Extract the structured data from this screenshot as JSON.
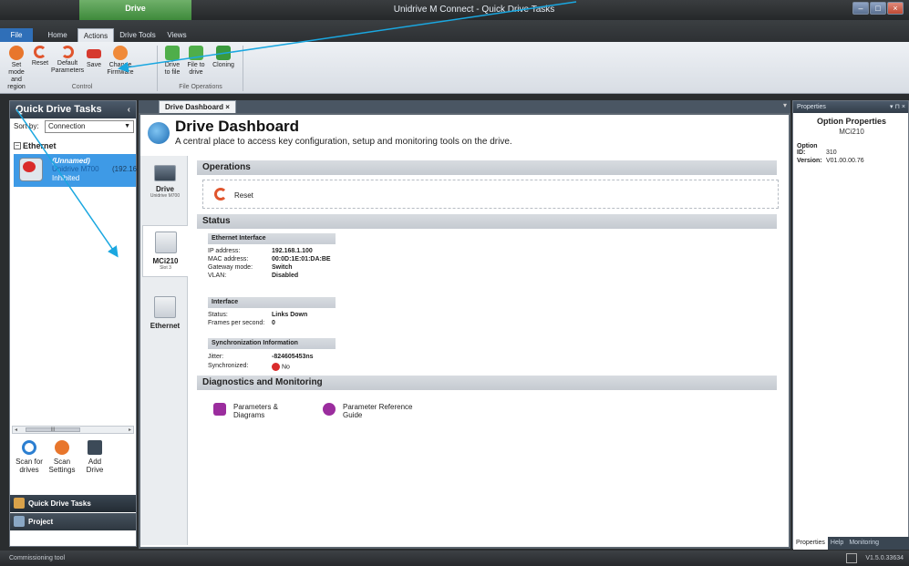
{
  "window": {
    "context_tab": "Drive",
    "title": "Unidrive M Connect - Quick Drive Tasks"
  },
  "ribbon_tabs": [
    "File",
    "Home",
    "Actions",
    "Drive Tools",
    "Views"
  ],
  "ribbon": {
    "control": {
      "label": "Control",
      "buttons": [
        {
          "l1": "Set mode",
          "l2": "and region",
          "icon_color": "#e8762c"
        },
        {
          "l1": "Reset",
          "l2": "",
          "icon_color": "#e0552d"
        },
        {
          "l1": "Default",
          "l2": "Parameters",
          "icon_color": "#e0552d"
        },
        {
          "l1": "Save",
          "l2": "",
          "icon_color": "#d63a2f"
        },
        {
          "l1": "Change",
          "l2": "Firmware",
          "icon_color": "#f08a3a"
        }
      ]
    },
    "file_operations": {
      "label": "File Operations",
      "buttons": [
        {
          "l1": "Drive",
          "l2": "to file",
          "icon_color": "#4fae4a"
        },
        {
          "l1": "File to",
          "l2": "drive",
          "icon_color": "#4fae4a"
        },
        {
          "l1": "Cloning",
          "l2": "",
          "icon_color": "#3a9a3e"
        }
      ]
    }
  },
  "left_pane": {
    "title": "Quick Drive Tasks",
    "collapse": "‹",
    "sort_label": "Sort by:",
    "sort_value": "Connection",
    "tree_root": "Ethernet",
    "drive": {
      "name": "(Unnamed)",
      "model": "Unidrive M700",
      "ip": "(192.16",
      "state": "Inhibited"
    },
    "scroll_grip": "III",
    "buttons": [
      {
        "l1": "Scan for",
        "l2": "drives"
      },
      {
        "l1": "Scan",
        "l2": "Settings"
      },
      {
        "l1": "Add",
        "l2": "Drive"
      }
    ],
    "nav": [
      "Quick Drive Tasks",
      "Project"
    ]
  },
  "doc_tab": "Drive Dashboard ×",
  "dashboard": {
    "title": "Drive Dashboard",
    "subtitle": "A central place to access key configuration, setup and monitoring tools on the drive.",
    "nav": [
      {
        "label": "Drive",
        "sub": "Unidrive M700"
      },
      {
        "label": "MCi210",
        "sub": "Slot 3"
      },
      {
        "label": "Ethernet",
        "sub": ""
      }
    ],
    "sections": {
      "operations": "Operations",
      "status": "Status",
      "diagnostics": "Diagnostics and Monitoring"
    },
    "reset_label": "Reset",
    "ethernet_interface": {
      "title": "Ethernet Interface",
      "rows": [
        {
          "k": "IP address:",
          "v": "192.168.1.100"
        },
        {
          "k": "MAC address:",
          "v": "00:0D:1E:01:DA:BE"
        },
        {
          "k": "Gateway mode:",
          "v": "Switch"
        },
        {
          "k": "VLAN:",
          "v": "Disabled"
        }
      ]
    },
    "interface": {
      "title": "Interface",
      "rows": [
        {
          "k": "Status:",
          "v": "Links Down"
        },
        {
          "k": "Frames per second:",
          "v": "0"
        }
      ]
    },
    "sync": {
      "title": "Synchronization Information",
      "rows": [
        {
          "k": "Jitter:",
          "v": "-824605453ns"
        },
        {
          "k": "Synchronized:",
          "v": "No"
        }
      ]
    },
    "diag_items": [
      {
        "l1": "Parameters &",
        "l2": "Diagrams",
        "icon_color": "#9b2d9e"
      },
      {
        "l1": "Parameter Reference",
        "l2": "Guide",
        "icon_color": "#9b2d9e"
      }
    ]
  },
  "properties": {
    "pane_title": "Properties",
    "pane_ctrl": "▾ ⊓ ×",
    "title": "Option Properties",
    "name": "MCi210",
    "option_id_label": "Option ID:",
    "option_id": "310",
    "version_label": "Version:",
    "version": "V01.00.00.76",
    "tabs": [
      "Properties",
      "Help",
      "Monitoring"
    ]
  },
  "status_bar": {
    "left": "Commissioning tool",
    "right": "V1.5.0.33634"
  },
  "colors": {
    "accent": "#3e9ae6",
    "arrow": "#1aa7e0"
  }
}
